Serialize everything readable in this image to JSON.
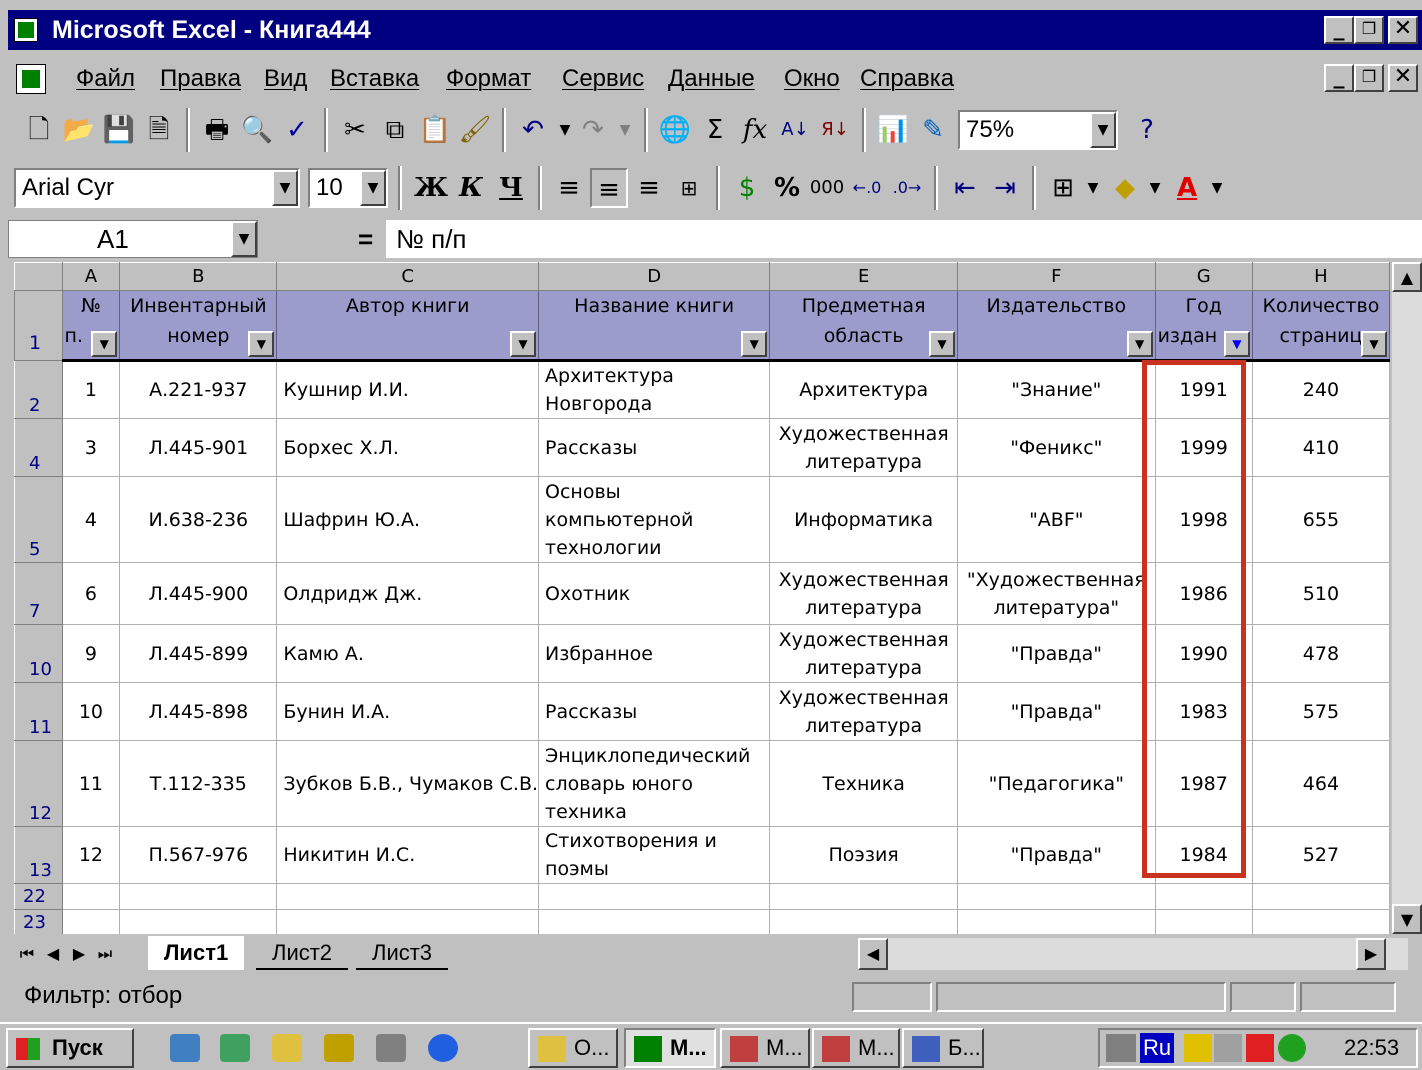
{
  "window": {
    "title": "Microsoft Excel - Книга444"
  },
  "menu": [
    "Файл",
    "Правка",
    "Вид",
    "Вставка",
    "Формат",
    "Сервис",
    "Данные",
    "Окно",
    "Справка"
  ],
  "toolbar": {
    "zoom": "75%",
    "font": "Arial Cyr",
    "size": "10",
    "bold": "Ж",
    "italic": "К",
    "underline": "Ч",
    "percent": "%",
    "thousands": "000"
  },
  "formula": {
    "cell": "A1",
    "equals": "=",
    "content": "№ п/п"
  },
  "columns": [
    "A",
    "B",
    "C",
    "D",
    "E",
    "F",
    "G",
    "H"
  ],
  "headers": [
    {
      "l1": "№",
      "l2": "п."
    },
    {
      "l1": "Инвентарный",
      "l2": "номер"
    },
    {
      "l1": "Автор книги",
      "l2": ""
    },
    {
      "l1": "Название книги",
      "l2": ""
    },
    {
      "l1": "Предметная",
      "l2": "область"
    },
    {
      "l1": "Издательство",
      "l2": ""
    },
    {
      "l1": "Год",
      "l2": "издан"
    },
    {
      "l1": "Количество",
      "l2": "страниц"
    }
  ],
  "header_row_num": "1",
  "rows": [
    {
      "n": "2",
      "c": [
        "1",
        "А.221-937",
        "Кушнир И.И.",
        "Архитектура Новгорода",
        "Архитектура",
        "\"Знание\"",
        "1991",
        "240"
      ]
    },
    {
      "n": "4",
      "c": [
        "3",
        "Л.445-901",
        "Борхес Х.Л.",
        "Рассказы",
        "Художественная литература",
        "\"Феникс\"",
        "1999",
        "410"
      ]
    },
    {
      "n": "5",
      "c": [
        "4",
        "И.638-236",
        "Шафрин Ю.А.",
        "Основы компьютерной технологии",
        "Информатика",
        "\"ABF\"",
        "1998",
        "655"
      ]
    },
    {
      "n": "7",
      "c": [
        "6",
        "Л.445-900",
        "Олдридж Дж.",
        "Охотник",
        "Художественная литература",
        "\"Художественная литература\"",
        "1986",
        "510"
      ]
    },
    {
      "n": "10",
      "c": [
        "9",
        "Л.445-899",
        "Камю А.",
        "Избранное",
        "Художественная литература",
        "\"Правда\"",
        "1990",
        "478"
      ]
    },
    {
      "n": "11",
      "c": [
        "10",
        "Л.445-898",
        "Бунин И.А.",
        "Рассказы",
        "Художественная литература",
        "\"Правда\"",
        "1983",
        "575"
      ]
    },
    {
      "n": "12",
      "c": [
        "11",
        "Т.112-335",
        "Зубков Б.В., Чумаков С.В.",
        "Энциклопедический словарь юного техника",
        "Техника",
        "\"Педагогика\"",
        "1987",
        "464"
      ]
    },
    {
      "n": "13",
      "c": [
        "12",
        "П.567-976",
        "Никитин И.С.",
        "Стихотворения и поэмы",
        "Поэзия",
        "\"Правда\"",
        "1984",
        "527"
      ]
    }
  ],
  "empty_rows": [
    "22",
    "23"
  ],
  "sheets": [
    "Лист1",
    "Лист2",
    "Лист3"
  ],
  "status": "Фильтр: отбор",
  "taskbar": {
    "start": "Пуск",
    "tasks": [
      "О...",
      "М...",
      "М...",
      "М...",
      "Б..."
    ],
    "lang": "Ru",
    "time": "22:53"
  },
  "colors": {
    "title": "#000080",
    "header_fill": "#9c9ccc",
    "highlight": "#c8321e"
  }
}
